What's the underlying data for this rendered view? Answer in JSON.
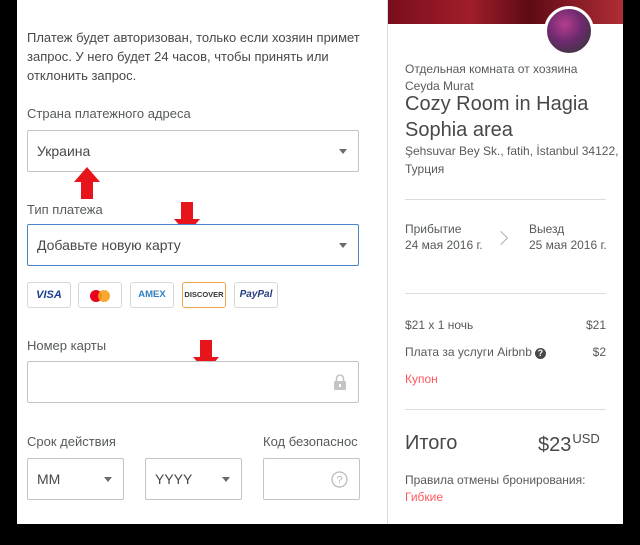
{
  "payment": {
    "notice": "Платеж будет авторизован, только если хозяин примет запрос. У него будет 24 часов, чтобы принять или отклонить запрос.",
    "country_label": "Страна платежного адреса",
    "country_value": "Украина",
    "payment_type_label": "Тип платежа",
    "payment_type_value": "Добавьте новую карту",
    "card_brands": [
      "VISA",
      "AMEX",
      "DISCOVER",
      "PayPal"
    ],
    "card_number_label": "Номер карты",
    "expiry_label": "Срок действия",
    "month_value": "MM",
    "year_value": "YYYY",
    "cvv_label": "Код безопаснос"
  },
  "summary": {
    "host_line": "Отдельная комната от хозяина Ceyda Murat",
    "listing_title": "Cozy Room in Hagia Sophia area",
    "address": "Şehsuvar Bey Sk., fatih, İstanbul 34122, Турция",
    "checkin_label": "Прибытие",
    "checkin_date": "24 мая 2016 г.",
    "checkout_label": "Выезд",
    "checkout_date": "25 мая 2016 г.",
    "nightly_label": "$21 x 1 ночь",
    "nightly_value": "$21",
    "service_label": "Плата за услуги Airbnb",
    "service_value": "$2",
    "coupon": "Купон",
    "total_label": "Итого",
    "total_value": "$23",
    "total_currency": "USD",
    "policy_label": "Правила отмены бронирования:",
    "policy_value": "Гибкие"
  },
  "colors": {
    "accent_red": "#ff5a5f",
    "annotation_arrow": "#e8141b",
    "focus_border": "#4a86c5"
  }
}
